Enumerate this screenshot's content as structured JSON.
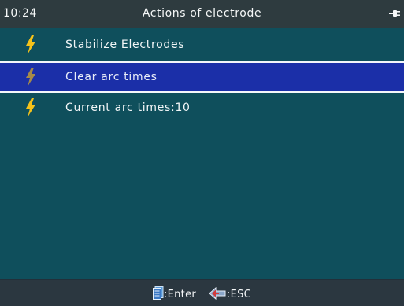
{
  "header": {
    "time": "10:24",
    "title": "Actions of electrode",
    "status_icon": "plug-icon"
  },
  "menu": {
    "items": [
      {
        "label": "Stabilize Electrodes",
        "icon": "lightning-bolt-icon",
        "selected": false
      },
      {
        "label": "Clear arc times",
        "icon": "lightning-bolt-icon",
        "selected": true
      },
      {
        "label": "Current arc times:10",
        "icon": "lightning-bolt-icon",
        "selected": false
      }
    ]
  },
  "footer": {
    "enter_label": ":Enter",
    "esc_label": ":ESC",
    "enter_icon": "enter-key-icon",
    "esc_icon": "esc-key-icon"
  },
  "colors": {
    "background": "#0f4f5c",
    "header_bar": "#2e3b3f",
    "footer_bar": "#2b3740",
    "selection": "#1b2fa8",
    "bolt_yellow": "#f5c21a",
    "bolt_dim": "#a58a4a",
    "esc_icon_red": "#d23a3a"
  }
}
